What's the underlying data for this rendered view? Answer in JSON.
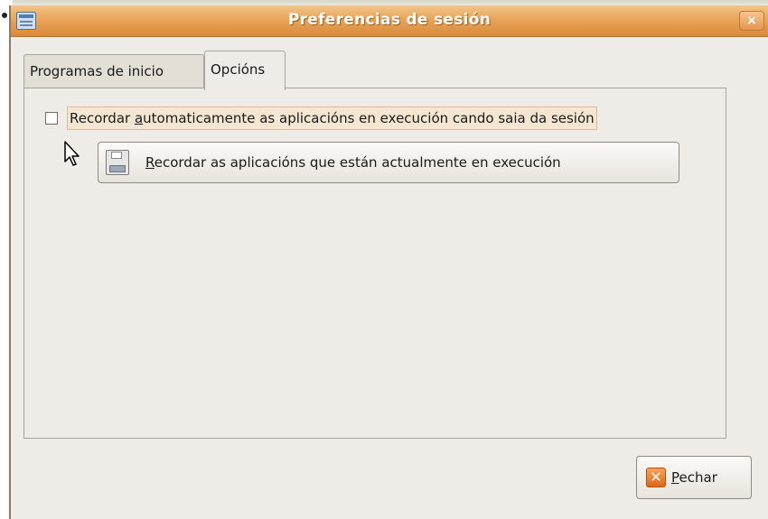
{
  "window": {
    "title": "Preferencias de sesión",
    "close_glyph": "×",
    "icon": "session-window-icon"
  },
  "tabs": [
    {
      "label": "Programas de inicio",
      "active": false
    },
    {
      "label": "Opcións",
      "active": true
    }
  ],
  "options": {
    "checkbox": {
      "checked": false,
      "label_pre": "Recordar ",
      "label_mnemonic": "a",
      "label_post": "utomaticamente as aplicacións en execución cando saia da sesión"
    },
    "remember_button": {
      "icon": "floppy-disk-icon",
      "label_mnemonic": "R",
      "label_post": "ecordar as aplicacións que están actualmente en execución"
    }
  },
  "footer": {
    "close_button": {
      "icon": "close-x-icon",
      "icon_glyph": "✕",
      "label_mnemonic": "P",
      "label_post": "echar"
    }
  },
  "colors": {
    "titlebar": "#e8a55a",
    "window_bg": "#efebe7",
    "accent": "#e0661a"
  }
}
